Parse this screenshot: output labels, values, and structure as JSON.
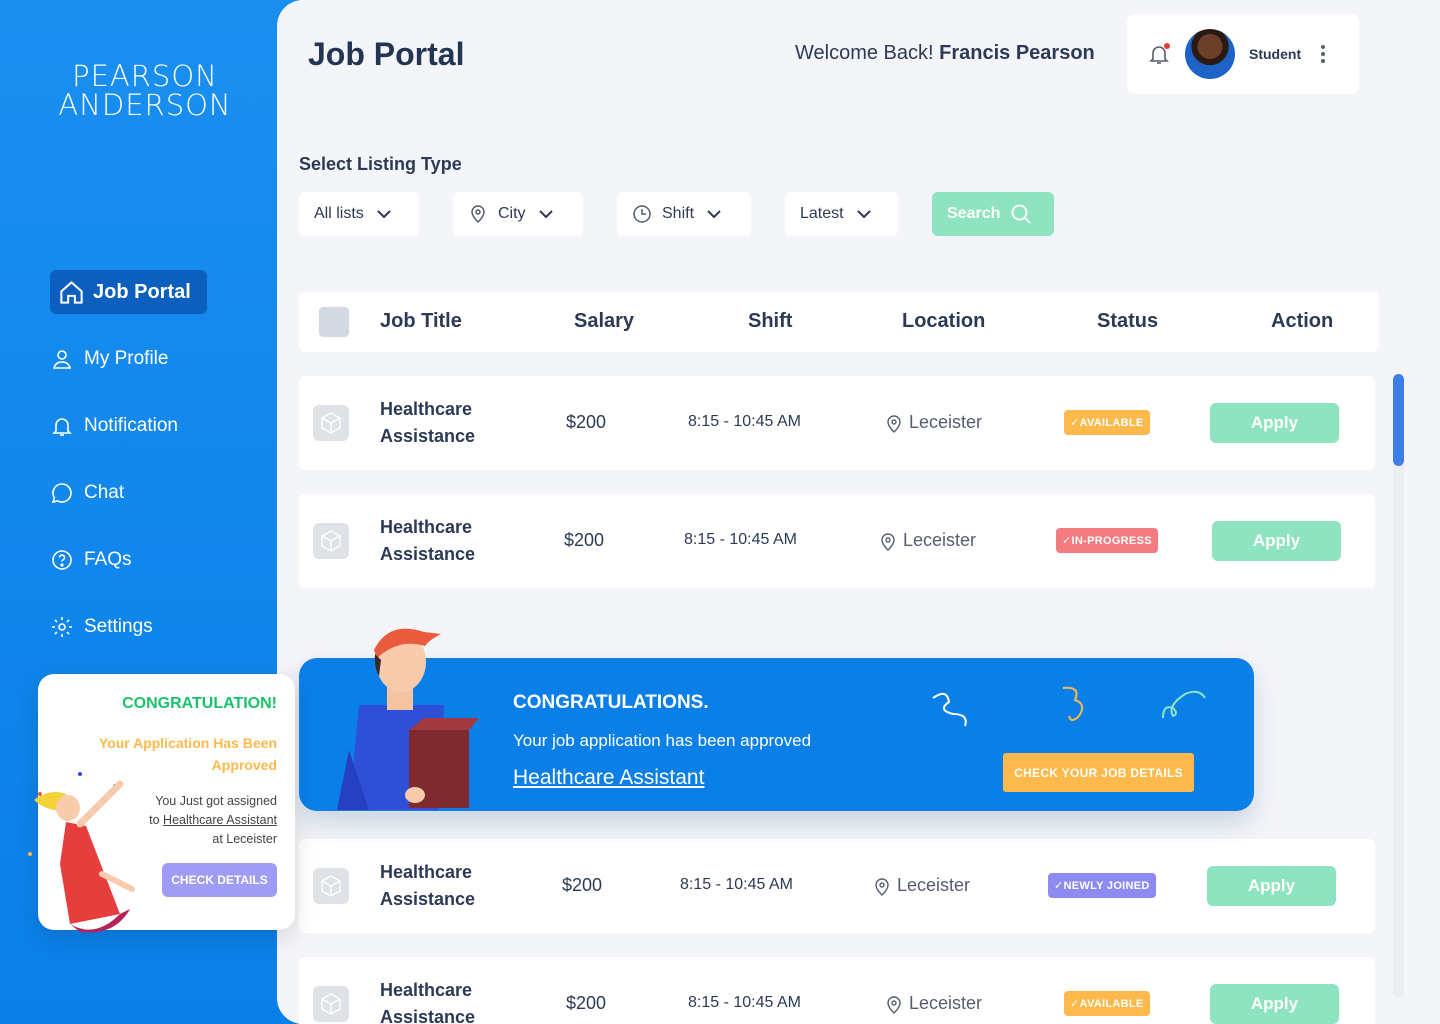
{
  "brand": {
    "line1": "PEARSON",
    "line2": "ANDERSON"
  },
  "sidebar": {
    "items": [
      {
        "label": "Job Portal",
        "icon": "home-icon",
        "active": true
      },
      {
        "label": "My Profile",
        "icon": "user-icon"
      },
      {
        "label": "Notification",
        "icon": "bell-icon"
      },
      {
        "label": "Chat",
        "icon": "chat-icon"
      },
      {
        "label": "FAQs",
        "icon": "question-icon"
      },
      {
        "label": "Settings",
        "icon": "gear-icon"
      }
    ]
  },
  "header": {
    "title": "Job Portal",
    "welcome_prefix": "Welcome Back!",
    "user_name": "Francis Pearson",
    "user_role": "Student"
  },
  "filters": {
    "label": "Select Listing Type",
    "list": "All lists",
    "city": "City",
    "shift": "Shift",
    "sort": "Latest",
    "search": "Search"
  },
  "table": {
    "columns": [
      "Job Title",
      "Salary",
      "Shift",
      "Location",
      "Status",
      "Action"
    ],
    "rows": [
      {
        "title": "Healthcare Assistance",
        "salary": "$200",
        "shift": "8:15 - 10:45 AM",
        "location": "Leceister",
        "status": "AVAILABLE",
        "action": "Apply"
      },
      {
        "title": "Healthcare Assistance",
        "salary": "$200",
        "shift": "8:15 - 10:45 AM",
        "location": "Leceister",
        "status": "IN-PROGRESS",
        "action": "Apply"
      },
      {
        "title": "Healthcare Assistance",
        "salary": "$200",
        "shift": "8:15 - 10:45 AM",
        "location": "Leceister",
        "status": "NEWLY JOINED",
        "action": "Apply"
      },
      {
        "title": "Healthcare Assistance",
        "salary": "$200",
        "shift": "8:15 - 10:45 AM",
        "location": "Leceister",
        "status": "AVAILABLE",
        "action": "Apply"
      }
    ]
  },
  "banner": {
    "title": "CONGRATULATIONS.",
    "text": "Your job application has been approved",
    "link": "Healthcare Assistant",
    "button": "CHECK YOUR JOB DETAILS"
  },
  "card": {
    "title": "CONGRATULATION!",
    "subtitle": "Your Application Has Been Approved",
    "body_1": "You Just got assigned",
    "body_2": "to",
    "body_link": "Healthcare Assistant",
    "body_3": "at Leceister",
    "button": "CHECK DETAILS"
  },
  "colors": {
    "primary": "#0a7fe8",
    "accent_green": "#8ee4c0",
    "badge_available": "#fdb94b",
    "badge_inprogress": "#f47b80",
    "badge_newly": "#8d8af2"
  }
}
